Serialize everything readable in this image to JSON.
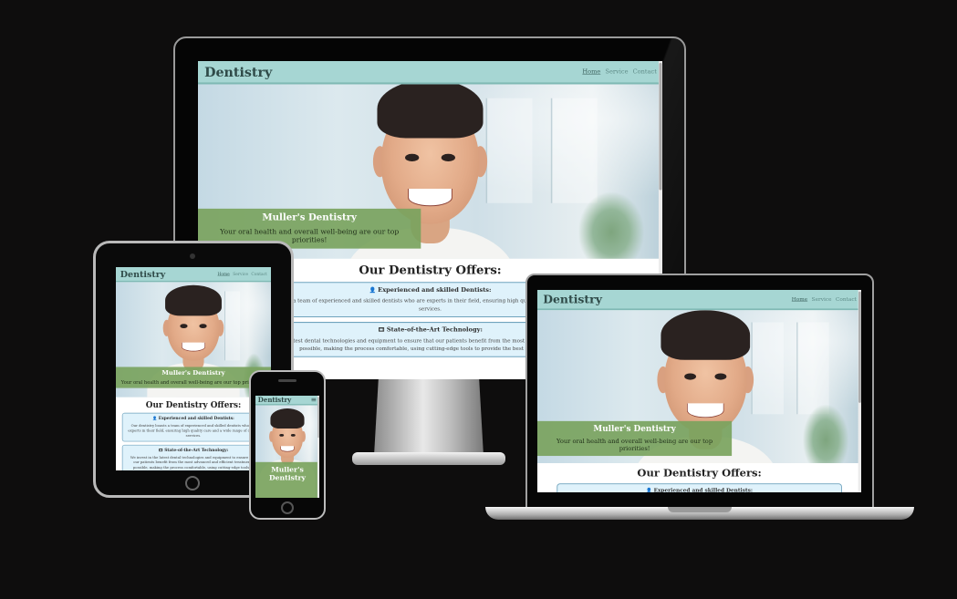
{
  "site": {
    "brand": "Dentistry",
    "nav": [
      {
        "label": "Home",
        "active": true
      },
      {
        "label": "Service",
        "active": false
      },
      {
        "label": "Contact",
        "active": false
      }
    ],
    "hamburger": "≡",
    "hero": {
      "title": "Muller's Dentistry",
      "tagline": "Your oral health and overall well-being are our top priorities!"
    },
    "offers": {
      "heading": "Our Dentistry Offers:",
      "cards": [
        {
          "icon": "👤",
          "title": "Experienced and skilled Dentists:",
          "text": "Our dentistry boasts a team of experienced and skilled dentists who are experts in their field, ensuring high quality care and a wide range of dental services."
        },
        {
          "icon": "🎞",
          "title": "State-of-the-Art Technology:",
          "text": "We invest in the latest dental technologies and equipment to ensure that our patients benefit from the most advanced and efficient treatments possible, making the process comfortable, using cutting-edge tools to provide the best possible care."
        }
      ]
    }
  },
  "colors": {
    "page_bg": "#0e0d0d",
    "header_bg": "#a6d6d3",
    "caption_bg": "#7aa35e",
    "card_bg": "#dff2fb",
    "card_border": "#6fa3bd"
  }
}
